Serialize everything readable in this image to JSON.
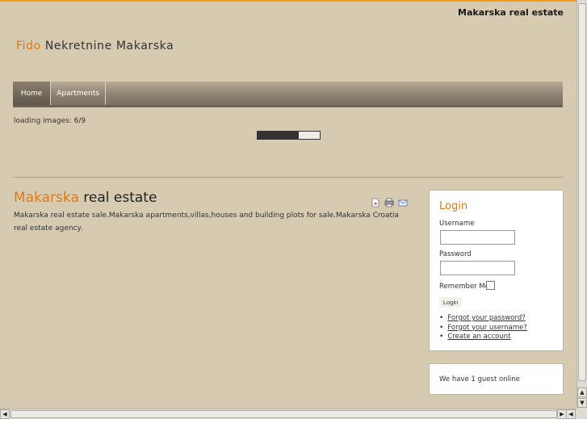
{
  "header": {
    "site_title": "Makarska real estate",
    "logo_accent": "Fido",
    "logo_rest": " Nekretnine Makarska"
  },
  "menu": {
    "items": [
      {
        "label": "Home",
        "active": true
      },
      {
        "label": "Apartments",
        "active": false
      }
    ]
  },
  "loader": {
    "text": "loading images: 6/9",
    "progress": 0.667
  },
  "article": {
    "title_accent": "Makarska",
    "title_rest": " real estate",
    "body": "Makarska real estate sale.Makarska apartments,villas,houses and building plots for sale.Makarska Croatia real estate agency.",
    "icons": [
      "pdf-icon",
      "print-icon",
      "email-icon"
    ]
  },
  "login": {
    "title": "Login",
    "username_label": "Username",
    "username_value": "",
    "password_label": "Password",
    "password_value": "",
    "remember_label": "Remember Me",
    "remember_checked": false,
    "button_label": "Login",
    "links": [
      "Forgot your password?",
      "Forgot your username?",
      "Create an account"
    ]
  },
  "online": {
    "text": "We have 1 guest online"
  },
  "scrollbars": {
    "up": "▲",
    "down": "▼",
    "left": "◀",
    "right": "▶"
  },
  "colors": {
    "accent": "#e07a12",
    "background": "#d6cab0",
    "menu": "#8f8473"
  }
}
